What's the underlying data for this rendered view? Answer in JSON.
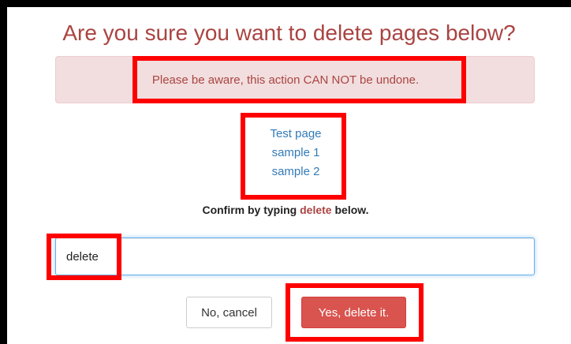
{
  "dialog": {
    "title": "Are you sure you want to delete pages below?",
    "warning": "Please be aware, this action CAN NOT be undone.",
    "pages": [
      "Test page",
      "sample 1",
      "sample 2"
    ],
    "confirm_prefix": "Confirm by typing ",
    "confirm_keyword": "delete",
    "confirm_suffix": " below.",
    "input_value": "delete",
    "cancel_label": "No, cancel",
    "delete_label": "Yes, delete it."
  },
  "colors": {
    "title": "#a94442",
    "alert_bg": "#f2dede",
    "link": "#337ab7",
    "danger_button": "#d9534f",
    "highlight": "#ff0000"
  }
}
